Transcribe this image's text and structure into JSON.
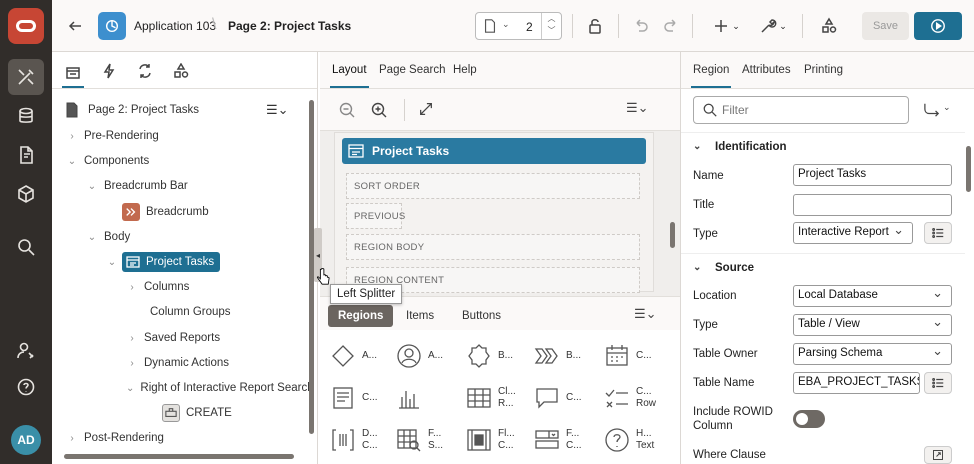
{
  "toolbar": {
    "app_name": "Application 103",
    "page_name": "Page 2: Project Tasks",
    "page_number": "2",
    "save_label": "Save"
  },
  "left_nav": {
    "icons": [
      "oracle-logo",
      "tools-icon",
      "database-icon",
      "page-edit-icon",
      "package-icon",
      "search-icon",
      "user-settings-icon",
      "help-icon"
    ],
    "avatar_initials": "AD"
  },
  "tree": {
    "header": "Page 2: Project Tasks",
    "items": [
      {
        "label": "Pre-Rendering"
      },
      {
        "label": "Components"
      },
      {
        "label": "Breadcrumb Bar"
      },
      {
        "label": "Breadcrumb"
      },
      {
        "label": "Body"
      },
      {
        "label": "Project Tasks"
      },
      {
        "label": "Columns"
      },
      {
        "label": "Column Groups"
      },
      {
        "label": "Saved Reports"
      },
      {
        "label": "Dynamic Actions"
      },
      {
        "label": "Right of Interactive Report Search"
      },
      {
        "label": "CREATE"
      },
      {
        "label": "Post-Rendering"
      }
    ],
    "tooltip": "Left Splitter"
  },
  "layout": {
    "tabs": [
      "Layout",
      "Page Search",
      "Help"
    ],
    "region_title": "Project Tasks",
    "slots": [
      "SORT ORDER",
      "PREVIOUS",
      "REGION BODY",
      "REGION CONTENT"
    ],
    "gallery_tabs": [
      "Regions",
      "Items",
      "Buttons"
    ],
    "gallery": [
      {
        "label1": "A...",
        "label2": ""
      },
      {
        "label1": "A...",
        "label2": ""
      },
      {
        "label1": "B...",
        "label2": ""
      },
      {
        "label1": "B...",
        "label2": ""
      },
      {
        "label1": "C...",
        "label2": ""
      },
      {
        "label1": "C...",
        "label2": ""
      },
      {
        "label1": "",
        "label2": ""
      },
      {
        "label1": "Cl...",
        "label2": "R..."
      },
      {
        "label1": "C...",
        "label2": ""
      },
      {
        "label1": "C...",
        "label2": "Row"
      },
      {
        "label1": "D...",
        "label2": "C..."
      },
      {
        "label1": "F...",
        "label2": "S..."
      },
      {
        "label1": "Fl...",
        "label2": "C..."
      },
      {
        "label1": "F...",
        "label2": "C..."
      },
      {
        "label1": "H...",
        "label2": "Text"
      }
    ]
  },
  "props": {
    "tabs": [
      "Region",
      "Attributes",
      "Printing"
    ],
    "filter_placeholder": "Filter",
    "identification": {
      "header": "Identification",
      "name_label": "Name",
      "name_value": "Project Tasks",
      "title_label": "Title",
      "title_value": "",
      "type_label": "Type",
      "type_value": "Interactive Report"
    },
    "source": {
      "header": "Source",
      "location_label": "Location",
      "location_value": "Local Database",
      "type_label": "Type",
      "type_value": "Table / View",
      "owner_label": "Table Owner",
      "owner_value": "Parsing Schema",
      "table_label": "Table Name",
      "table_value": "EBA_PROJECT_TASKS",
      "rowid_label": "Include ROWID Column",
      "where_label": "Where Clause"
    }
  },
  "colors": {
    "accent": "#1e6f92",
    "nav_bg": "#312d2a",
    "logo": "#c74634"
  }
}
